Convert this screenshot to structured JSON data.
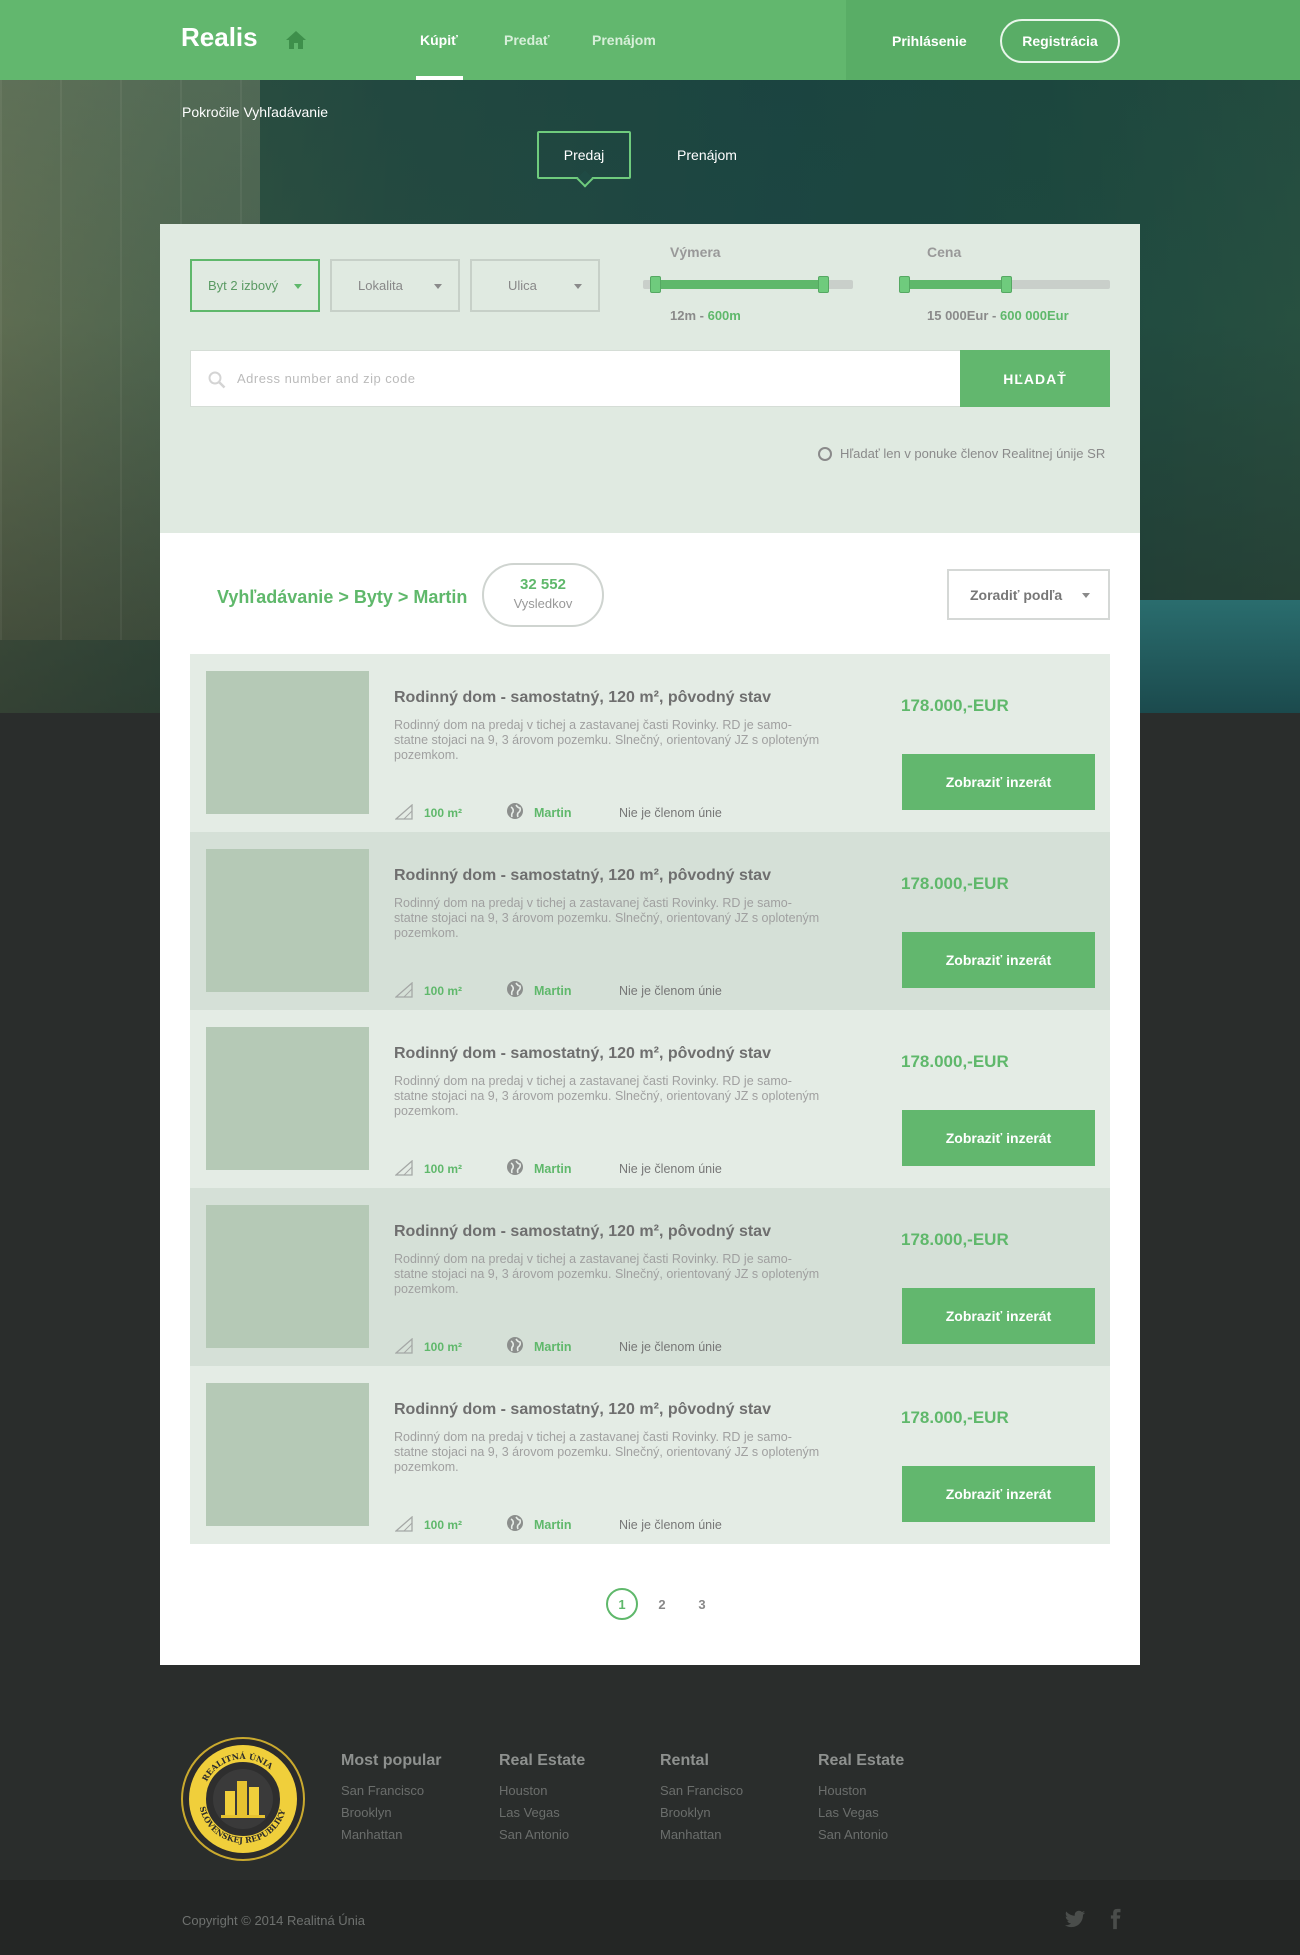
{
  "brand": "Realis",
  "nav": {
    "items": [
      "Kúpiť",
      "Predať",
      "Prenájom"
    ],
    "login": "Prihlásenie",
    "register": "Registrácia"
  },
  "search": {
    "title": "Pokročile Vyhľadávanie",
    "mode_tabs": [
      "Predaj",
      "Prenájom"
    ],
    "selects": [
      "Byt 2 izbový",
      "Lokalita",
      "Ulica"
    ],
    "area": {
      "label": "Výmera",
      "min": "12m",
      "sep": " - ",
      "max": "600m",
      "level_low": 0.05,
      "level_high": 0.86
    },
    "price": {
      "label": "Cena",
      "min": "15 000Eur",
      "sep": " - ",
      "max": "600 000Eur",
      "level_low": 0.0,
      "level_high": 0.5
    },
    "address_placeholder": "Adress number and zip code",
    "submit": "HĽADAŤ",
    "members_only": "Hľadať len v ponuke členov Realitnej únije SR"
  },
  "results": {
    "breadcrumb": "Vyhľadávanie > Byty > Martin",
    "count": "32 552",
    "count_label": "Vysledkov",
    "sort_label": "Zoradiť podľa",
    "listings": [
      {
        "title": "Rodinný dom - samostatný, 120 m², pôvodný stav",
        "desc": "Rodinný dom na predaj v tichej a zastavanej časti Rovinky. RD je samo-statne stojaci na 9, 3 árovom pozemku. Slnečný, orientovaný JZ s oploteným pozemkom.",
        "area": "100 m²",
        "city": "Martin",
        "member": "Nie je členom únie",
        "price": "178.000,-EUR",
        "button": "Zobraziť inzerát"
      },
      {
        "title": "Rodinný dom - samostatný, 120 m², pôvodný stav",
        "desc": "Rodinný dom na predaj v tichej a zastavanej časti Rovinky. RD je samo-statne stojaci na 9, 3 árovom pozemku. Slnečný, orientovaný JZ s oploteným pozemkom.",
        "area": "100 m²",
        "city": "Martin",
        "member": "Nie je členom únie",
        "price": "178.000,-EUR",
        "button": "Zobraziť inzerát"
      },
      {
        "title": "Rodinný dom - samostatný, 120 m², pôvodný stav",
        "desc": "Rodinný dom na predaj v tichej a zastavanej časti Rovinky. RD je samo-statne stojaci na 9, 3 árovom pozemku. Slnečný, orientovaný JZ s oploteným pozemkom.",
        "area": "100 m²",
        "city": "Martin",
        "member": "Nie je členom únie",
        "price": "178.000,-EUR",
        "button": "Zobraziť inzerát"
      },
      {
        "title": "Rodinný dom - samostatný, 120 m², pôvodný stav",
        "desc": "Rodinný dom na predaj v tichej a zastavanej časti Rovinky. RD je samo-statne stojaci na 9, 3 árovom pozemku. Slnečný, orientovaný JZ s oploteným pozemkom.",
        "area": "100 m²",
        "city": "Martin",
        "member": "Nie je členom únie",
        "price": "178.000,-EUR",
        "button": "Zobraziť inzerát"
      },
      {
        "title": "Rodinný dom - samostatný, 120 m², pôvodný stav",
        "desc": "Rodinný dom na predaj v tichej a zastavanej časti Rovinky. RD je samo-statne stojaci na 9, 3 árovom pozemku. Slnečný, orientovaný JZ s oploteným pozemkom.",
        "area": "100 m²",
        "city": "Martin",
        "member": "Nie je členom únie",
        "price": "178.000,-EUR",
        "button": "Zobraziť inzerát"
      }
    ],
    "pages": [
      "1",
      "2",
      "3"
    ],
    "current_page": "1"
  },
  "footer": {
    "seal_text": "REALITNÁ ÚNIA SLOVENSKEJ REPUBLIKY",
    "columns": [
      {
        "heading": "Most popular",
        "links": [
          "San Francisco",
          "Brooklyn",
          "Manhattan"
        ]
      },
      {
        "heading": "Real Estate",
        "links": [
          "Houston",
          "Las Vegas",
          "San Antonio"
        ]
      },
      {
        "heading": "Rental",
        "links": [
          "San Francisco",
          "Brooklyn",
          "Manhattan"
        ]
      },
      {
        "heading": "Real Estate",
        "links": [
          "Houston",
          "Las Vegas",
          "San Antonio"
        ]
      }
    ],
    "copyright": "Copyright © 2014 Realitná Únia"
  },
  "icons": [
    "home-icon",
    "search-icon",
    "area-icon",
    "globe-icon",
    "twitter-icon",
    "facebook-icon"
  ],
  "colors": {
    "brand_green": "#62b76e",
    "accent_green": "#5fb86b",
    "panel_bg": "#e0eae1",
    "dark_bg": "#2a2d2c"
  }
}
